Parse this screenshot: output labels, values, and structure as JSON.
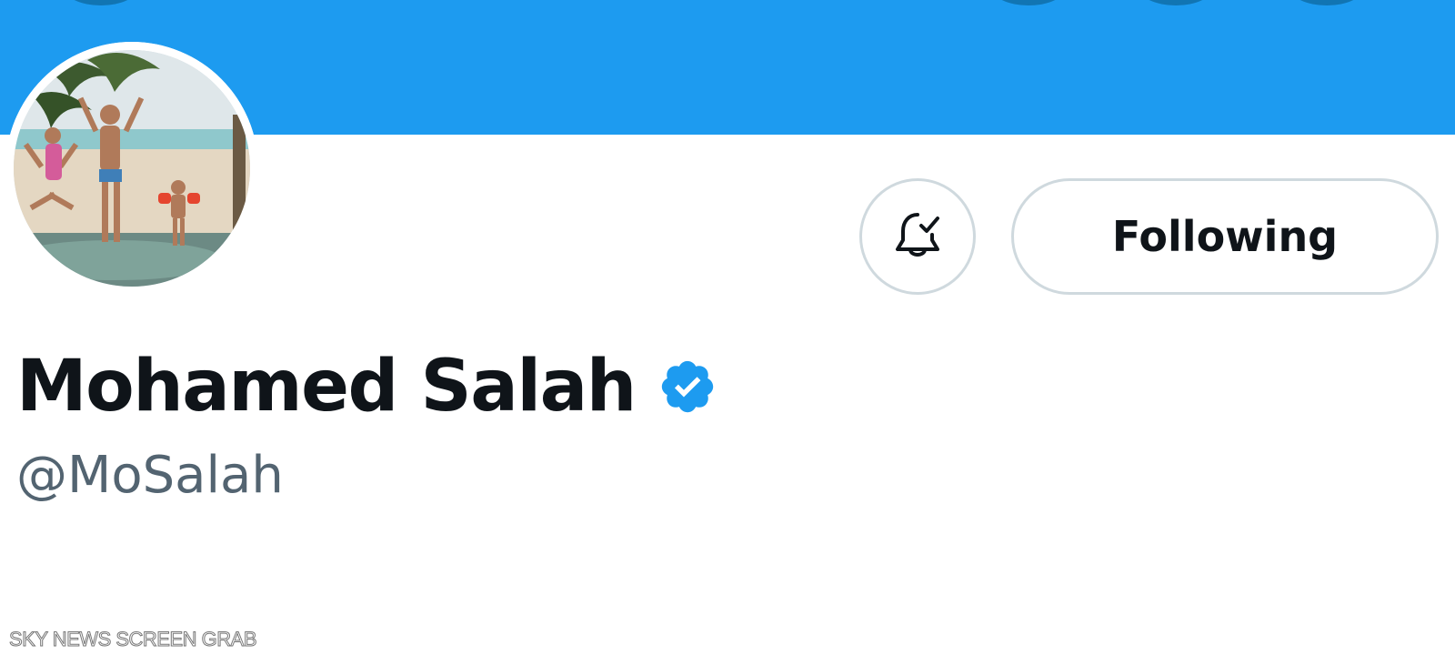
{
  "profile": {
    "display_name": "Mohamed Salah",
    "handle": "@MoSalah",
    "verified": true
  },
  "actions": {
    "follow_label": "Following",
    "notification_icon": "bell-check-icon"
  },
  "watermark": {
    "text": "SKY NEWS SCREEN GRAB"
  },
  "colors": {
    "banner": "#1d9bf0",
    "verified_badge": "#1d9bf0",
    "name_text": "#0f1419",
    "handle_text": "#536471",
    "button_border": "#cfd9de"
  }
}
